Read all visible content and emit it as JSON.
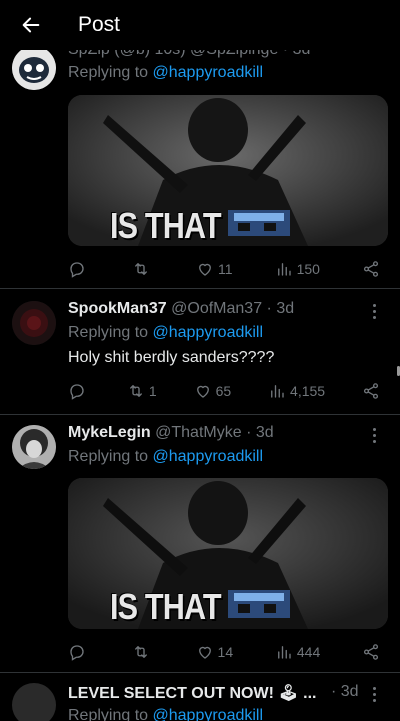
{
  "header": {
    "title": "Post"
  },
  "tweets": [
    {
      "partial_top": "SpZip (@b) 10s) @SpZipinge · 3d",
      "replying_prefix": "Replying to",
      "mention": "@happyroadkill",
      "media_text": "IS THAT",
      "reply_count": "",
      "repost_count": "",
      "like_count": "11",
      "view_count": "150"
    },
    {
      "name": "SpookMan37",
      "handle": "@OofMan37 · 3d",
      "replying_prefix": "Replying to",
      "mention": "@happyroadkill",
      "text": "Holy shit berdly sanders????",
      "reply_count": "",
      "repost_count": "1",
      "like_count": "65",
      "view_count": "4,155"
    },
    {
      "name": "MykeLegin",
      "handle": "@ThatMyke · 3d",
      "replying_prefix": "Replying to",
      "mention": "@happyroadkill",
      "media_text": "IS THAT",
      "reply_count": "",
      "repost_count": "",
      "like_count": "14",
      "view_count": "444"
    },
    {
      "name": "LEVEL SELECT OUT NOW! 🕹 ...",
      "handle": "· 3d",
      "replying_prefix": "Replying to",
      "mention": "@happyroadkill"
    }
  ],
  "icons": {
    "back": "arrow-left-icon",
    "reply": "speech-bubble-icon",
    "repost": "repost-arrows-icon",
    "like": "heart-icon",
    "views": "bar-chart-icon",
    "share": "share-icon",
    "more": "more-vertical-icon"
  },
  "colors": {
    "background": "#000000",
    "muted": "#71767b",
    "link": "#1d9bf0",
    "text": "#e7e9ea",
    "divider": "#2f3336"
  }
}
